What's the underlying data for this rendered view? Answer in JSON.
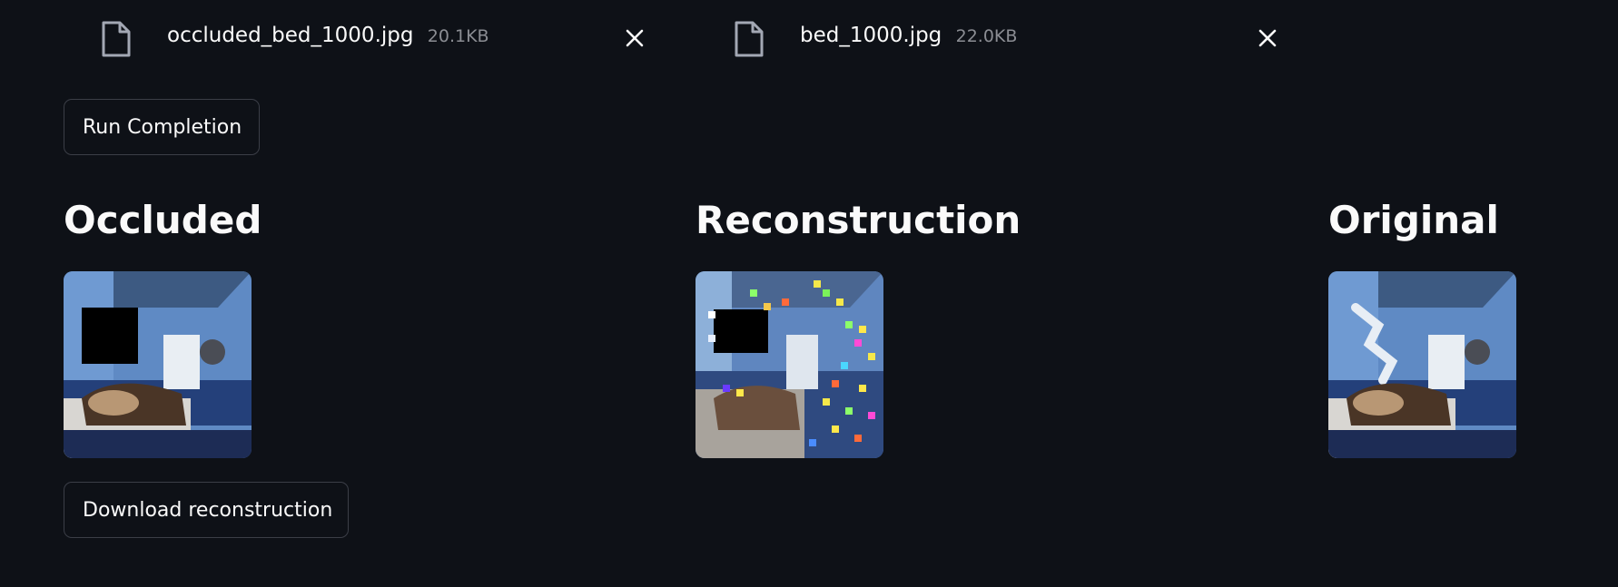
{
  "uploads": [
    {
      "name": "occluded_bed_1000.jpg",
      "size": "20.1KB"
    },
    {
      "name": "bed_1000.jpg",
      "size": "22.0KB"
    }
  ],
  "run_button_label": "Run Completion",
  "columns": [
    {
      "title": "Occluded"
    },
    {
      "title": "Reconstruction"
    },
    {
      "title": "Original"
    }
  ],
  "download_button_label": "Download reconstruction",
  "icons": {
    "file": "file-icon",
    "close": "close-icon"
  },
  "colors": {
    "background": "#0e1117",
    "text": "#fafafa",
    "muted": "#8b8d93",
    "border": "#3b3e47"
  }
}
